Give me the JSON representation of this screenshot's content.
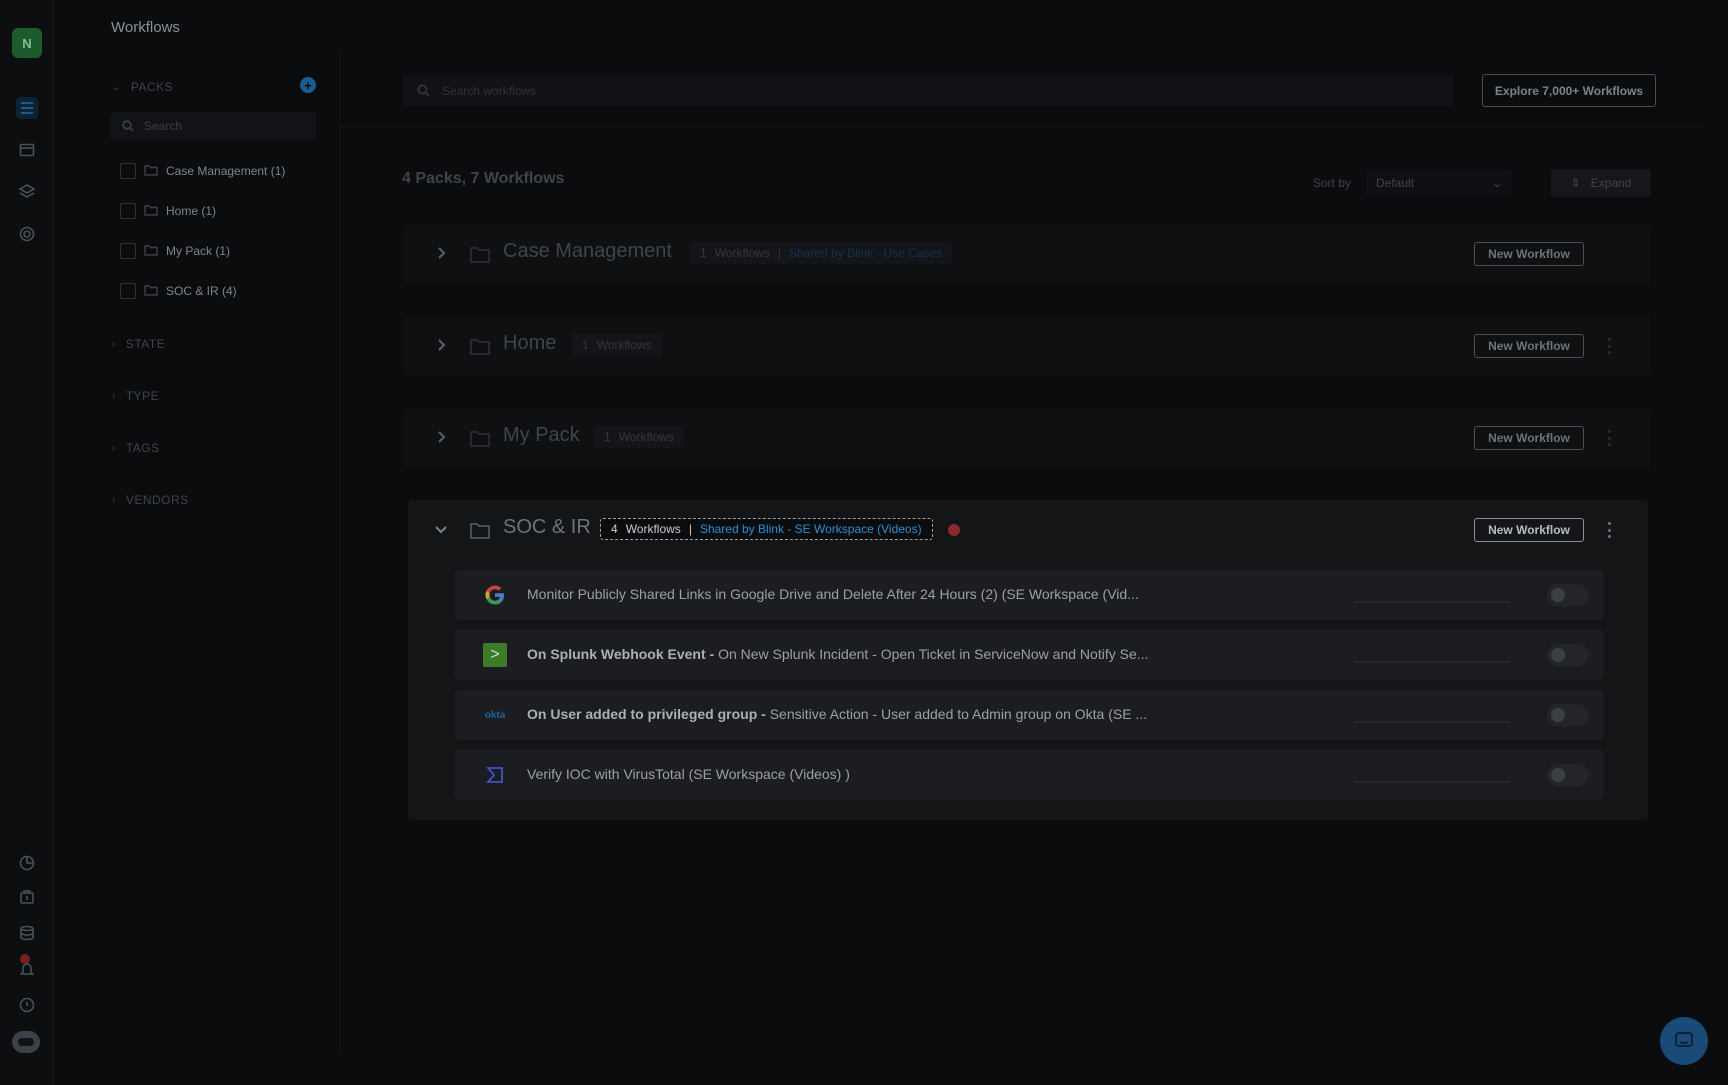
{
  "header": {
    "title": "Workflows"
  },
  "user": {
    "initial": "N"
  },
  "sidebar": {
    "packs_label": "PACKS",
    "add_icon": "plus-icon",
    "search_placeholder": "Search",
    "packs": [
      {
        "label": "Case Management (1)"
      },
      {
        "label": "Home (1)"
      },
      {
        "label": "My Pack (1)"
      },
      {
        "label": "SOC & IR (4)"
      }
    ],
    "sections": [
      {
        "label": "STATE"
      },
      {
        "label": "TYPE"
      },
      {
        "label": "TAGS"
      },
      {
        "label": "VENDORS"
      }
    ]
  },
  "main": {
    "search_placeholder": "Search workflows",
    "explore_label": "Explore 7,000+ Workflows",
    "summary": "4 Packs, 7 Workflows",
    "sort_label": "Sort by",
    "sort_value": "Default",
    "expand_label": "Expand",
    "new_workflow_label": "New Workflow",
    "packs": [
      {
        "name": "Case Management",
        "count": "1",
        "count_label": "Workflows",
        "sep": "|",
        "shared": "Shared by Blink - Use Cases"
      },
      {
        "name": "Home",
        "count": "1",
        "count_label": "Workflows"
      },
      {
        "name": "My Pack",
        "count": "1",
        "count_label": "Workflows"
      },
      {
        "name": "SOC & IR",
        "count": "4",
        "count_label": "Workflows",
        "sep": "|",
        "shared": "Shared by Blink - SE Workspace (Videos)"
      }
    ],
    "workflows": [
      {
        "icon": "google-icon",
        "bold": "",
        "text": "Monitor Publicly Shared Links in Google Drive and Delete After 24 Hours (2) (SE Workspace (Vid..."
      },
      {
        "icon": "terminal-icon",
        "bold": "On Splunk Webhook Event - ",
        "text": "On New Splunk Incident - Open Ticket in ServiceNow and Notify Se..."
      },
      {
        "icon": "okta-icon",
        "logo_text": "okta",
        "bold": "On User added to privileged group - ",
        "text": "Sensitive Action - User added to Admin group on Okta (SE ..."
      },
      {
        "icon": "virustotal-icon",
        "bold": "",
        "text": "Verify IOC with VirusTotal (SE Workspace (Videos) )"
      }
    ]
  },
  "colors": {
    "accent": "#2f8ecf",
    "alert": "#8a2a2a",
    "brand_green": "#1d5a2c"
  }
}
